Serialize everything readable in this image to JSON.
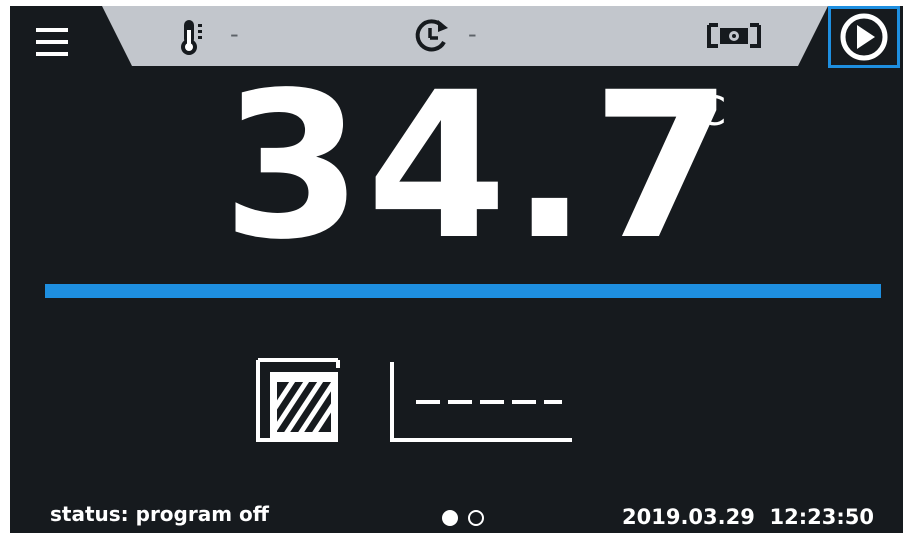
{
  "topbar": {
    "temperature_setpoint": "-",
    "timer_value": "-"
  },
  "main": {
    "temperature": "34.7",
    "unit": "°C"
  },
  "footer": {
    "status": "status: program off",
    "date": "2019.03.29",
    "time": "12:23:50",
    "page_indicator": {
      "current": 1,
      "total": 2
    }
  },
  "icons": {
    "menu": "hamburger-menu-icon",
    "thermometer": "thermometer-icon",
    "timer": "timer-icon",
    "camera": "camera-settings-icon",
    "play": "play-icon",
    "chamber": "chamber-icon",
    "graph": "temperature-graph-icon"
  },
  "colors": {
    "background": "#161a1e",
    "topbar": "#c2c6cc",
    "accent": "#1e8fe0",
    "text": "#ffffff"
  }
}
